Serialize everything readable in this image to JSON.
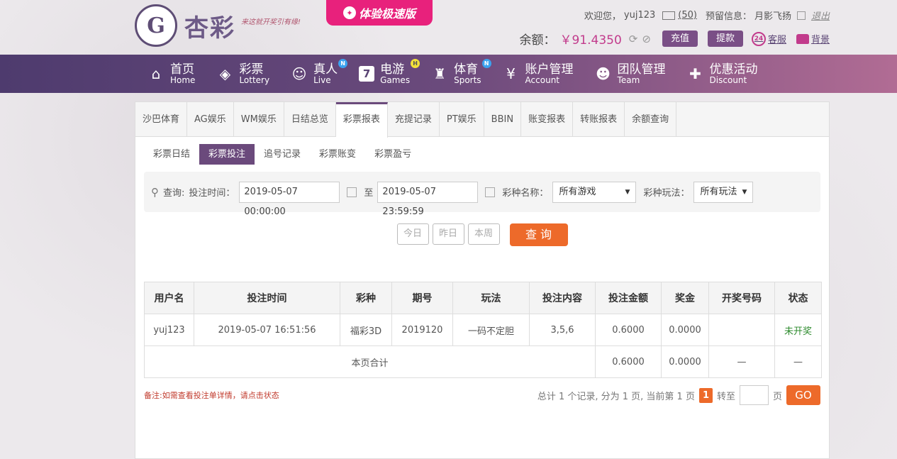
{
  "header": {
    "logo_text": "杏彩",
    "logo_slogan": "来这就开奖引有缘!",
    "promo_label": "体验极速版",
    "welcome": "欢迎您，",
    "username": "yuj123",
    "mail_count": "(50)",
    "reserve_label": "预留信息：",
    "reserve_value": "月影飞扬",
    "logout": "退出",
    "balance_label": "余额：",
    "balance_value": "￥91.4350",
    "recharge": "充值",
    "withdraw": "提款",
    "service": "客服",
    "background": "背景"
  },
  "nav": [
    {
      "cn": "首页",
      "en": "Home",
      "icon": "home-icon",
      "badge": ""
    },
    {
      "cn": "彩票",
      "en": "Lottery",
      "icon": "ticket-icon",
      "badge": ""
    },
    {
      "cn": "真人",
      "en": "Live",
      "icon": "person-icon",
      "badge": "N"
    },
    {
      "cn": "电游",
      "en": "Games",
      "icon": "seven-icon",
      "badge": "H"
    },
    {
      "cn": "体育",
      "en": "Sports",
      "icon": "trophy-icon",
      "badge": "N"
    },
    {
      "cn": "账户管理",
      "en": "Account",
      "icon": "yen-icon",
      "badge": ""
    },
    {
      "cn": "团队管理",
      "en": "Team",
      "icon": "team-icon",
      "badge": ""
    },
    {
      "cn": "优惠活动",
      "en": "Discount",
      "icon": "gift-icon",
      "badge": ""
    }
  ],
  "tabs": [
    "沙巴体育",
    "AG娱乐",
    "WM娱乐",
    "日结总览",
    "彩票报表",
    "充提记录",
    "PT娱乐",
    "BBIN",
    "账变报表",
    "转账报表",
    "余额查询"
  ],
  "active_tab": 4,
  "subtabs": [
    "彩票日结",
    "彩票投注",
    "追号记录",
    "彩票账变",
    "彩票盈亏"
  ],
  "active_subtab": 1,
  "filter": {
    "query_label": "查询:",
    "time_label": "投注时间：",
    "start_time": "2019-05-07 00:00:00",
    "to_label": "至",
    "end_time": "2019-05-07 23:59:59",
    "game_label": "彩种名称：",
    "game_value": "所有游戏",
    "play_label": "彩种玩法：",
    "play_value": "所有玩法"
  },
  "quick_buttons": [
    "今日",
    "昨日",
    "本周"
  ],
  "search_button": "查 询",
  "table": {
    "headers": [
      "用户名",
      "投注时间",
      "彩种",
      "期号",
      "玩法",
      "投注内容",
      "投注金额",
      "奖金",
      "开奖号码",
      "状态"
    ],
    "rows": [
      [
        "yuj123",
        "2019-05-07 16:51:56",
        "福彩3D",
        "2019120",
        "一码不定胆",
        "3,5,6",
        "0.6000",
        "0.0000",
        "",
        "未开奖"
      ]
    ],
    "summary": {
      "label": "本页合计",
      "amount": "0.6000",
      "bonus": "0.0000",
      "draw": "—",
      "status": "—"
    }
  },
  "note": "备注:如需查看投注单详情，请点击状态",
  "pager": {
    "text": "总计 1 个记录, 分为 1 页, 当前第 1 页",
    "current": "1",
    "goto_label": "转至",
    "page_label": "页",
    "go": "GO"
  }
}
